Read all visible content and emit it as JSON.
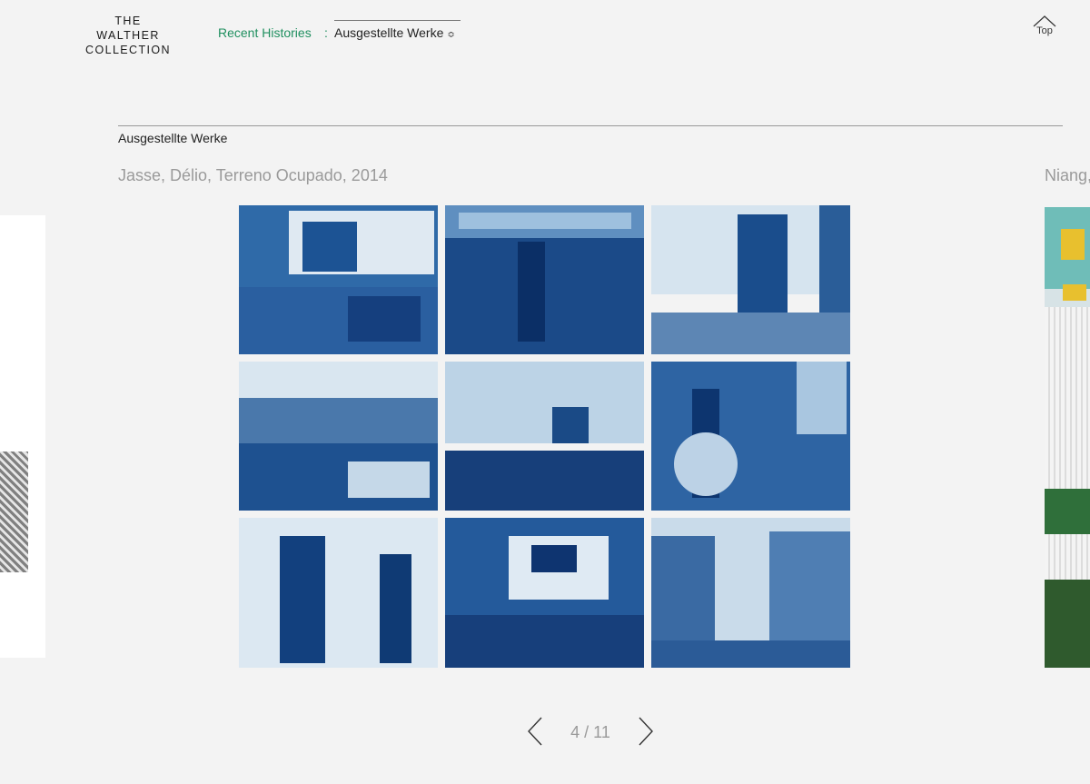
{
  "header": {
    "logo_line1": "THE",
    "logo_line2": "WALTHER COLLECTION",
    "breadcrumb_link": "Recent Histories",
    "breadcrumb_separator": ":",
    "breadcrumb_current": "Ausgestellte Werke",
    "select_arrows": "≎",
    "top_label": "Top"
  },
  "section": {
    "title": "Ausgestellte Werke"
  },
  "works": [
    {
      "caption": "Jasse, Délio, Terreno Ocupado, 2014"
    },
    {
      "caption": "Niang,"
    }
  ],
  "pager": {
    "current": 4,
    "total": 11,
    "display": "4 / 11"
  },
  "colors": {
    "background": "#f3f3f3",
    "accent": "#1f8f5f",
    "caption": "#9a9a9a",
    "cyanotype_dark": "#0e3a78",
    "cyanotype_light": "#c8dbe9"
  }
}
